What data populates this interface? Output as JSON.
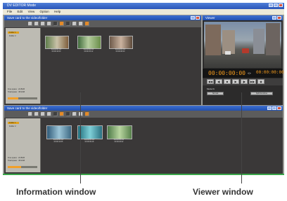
{
  "app": {
    "title": "DV EDITOR Mode",
    "menu": [
      "File",
      "Edit",
      "View",
      "Option",
      "Help"
    ]
  },
  "info_window_top": {
    "title": "Save card to the video/folder",
    "sidebar": {
      "folders": [
        "Folder 1",
        "Folder 2"
      ],
      "free_space": "Free space : 24.8GB",
      "total": "Total space : 38.2GB",
      "progress": 0.35
    },
    "clips": [
      {
        "name": "Scene001.DV",
        "time": "00:00:10:00"
      },
      {
        "name": "Scene002.DV",
        "time": "00:00:15:12"
      },
      {
        "name": "Scene003.DV",
        "time": "00:00:08:20"
      }
    ]
  },
  "info_window_bottom": {
    "title": "Save card to the video/folder",
    "sidebar": {
      "folders": [
        "Folder 1",
        "Folder 2"
      ],
      "free_space": "Free space : 24.8GB",
      "total": "Total space : 38.2GB",
      "progress": 0.45
    },
    "clips": [
      {
        "name": "Scene004.DV",
        "time": "00:00:12:05"
      },
      {
        "name": "Scene005.DV",
        "time": "00:00:09:18"
      },
      {
        "name": "Scene006.DV",
        "time": "00:00:20:02"
      }
    ]
  },
  "viewer": {
    "title": "Viewer",
    "timecode_current": "00:00:00:00",
    "timecode_total": "00:00:00:00",
    "timecode_sep": "<>",
    "controls": [
      "◀◀",
      "◀|",
      "■",
      "▶",
      "|▶",
      "▶▶",
      "◉"
    ],
    "mode_label": "Mode fit",
    "button_left": "Normal",
    "button_right": "Split/Combine"
  },
  "captions": {
    "information": "Information window",
    "viewer": "Viewer window"
  }
}
